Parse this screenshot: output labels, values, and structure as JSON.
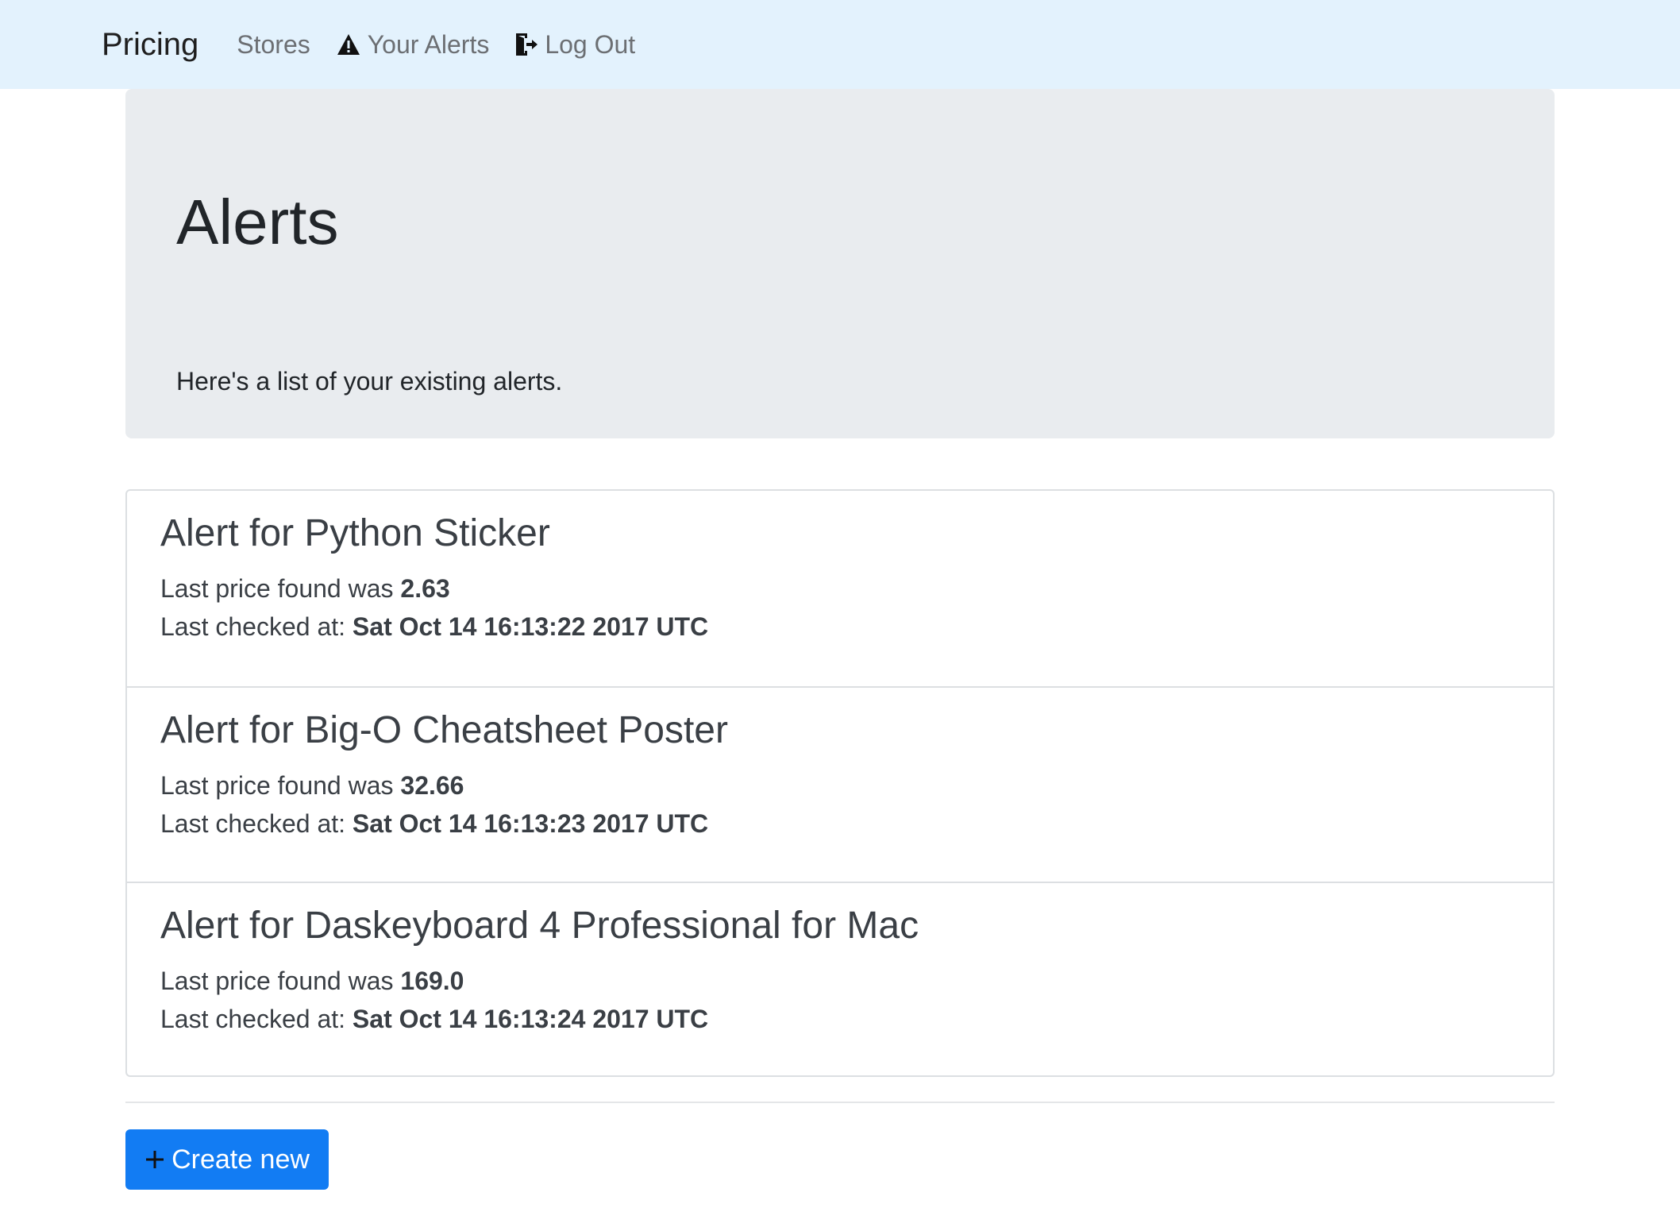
{
  "navbar": {
    "brand": "Pricing",
    "links": [
      {
        "label": "Stores",
        "icon": ""
      },
      {
        "label": "Your Alerts",
        "icon": "warning-icon"
      },
      {
        "label": "Log Out",
        "icon": "log-out-icon"
      }
    ]
  },
  "jumbotron": {
    "title": "Alerts",
    "subtitle": "Here's a list of your existing alerts."
  },
  "alerts": [
    {
      "title": "Alert for Python Sticker",
      "price_label": "Last price found was ",
      "price": "2.63",
      "checked_label": "Last checked at: ",
      "checked": "Sat Oct 14 16:13:22 2017 UTC"
    },
    {
      "title": "Alert for Big-O Cheatsheet Poster",
      "price_label": "Last price found was ",
      "price": "32.66",
      "checked_label": "Last checked at: ",
      "checked": "Sat Oct 14 16:13:23 2017 UTC"
    },
    {
      "title": "Alert for Daskeyboard 4 Professional for Mac",
      "price_label": "Last price found was ",
      "price": "169.0",
      "checked_label": "Last checked at: ",
      "checked": "Sat Oct 14 16:13:24 2017 UTC"
    }
  ],
  "create_button": {
    "label": "Create new",
    "icon": "plus-icon",
    "color": "#127cf3"
  },
  "colors": {
    "navbar_bg": "#e3f2fd",
    "jumbotron_bg": "#e9ecef",
    "accent": "#127cf3"
  }
}
